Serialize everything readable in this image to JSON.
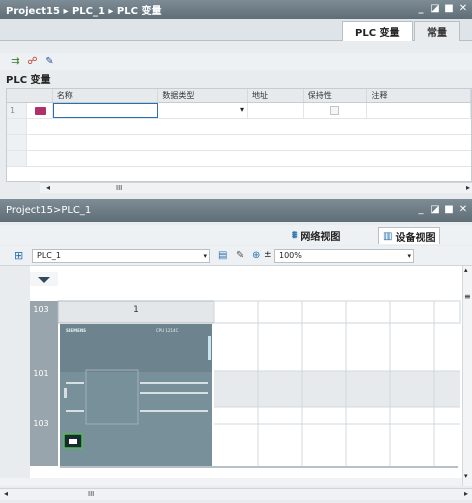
{
  "top_window": {
    "title": "Project15 ▸ PLC_1 ▸ PLC 变量",
    "controls": [
      "_",
      "◪",
      "■",
      "✕"
    ],
    "tabs": [
      {
        "label": "PLC 变量",
        "active": true
      },
      {
        "label": "常量",
        "active": false
      }
    ],
    "section": "PLC 变量",
    "columns": [
      "名称",
      "数据类型",
      "地址",
      "保持性",
      "注释"
    ],
    "rows": [
      {
        "num": "1"
      }
    ],
    "scroll_thumb": "III"
  },
  "bottom_window": {
    "title": "Project15>PLC_1",
    "controls": [
      "_",
      "◪",
      "■",
      "✕"
    ],
    "view_tabs": [
      {
        "label": "网络视图",
        "active": false
      },
      {
        "label": "设备视图",
        "active": true
      }
    ],
    "device_select": "PLC_1",
    "zoom": "100%",
    "rack": {
      "slot_numbers": [
        "103",
        "1"
      ],
      "row_labels": [
        "101",
        "103"
      ],
      "device_brand": "SIEMENS",
      "device_model": "CPU 1214C"
    },
    "scroll_thumb": "III"
  },
  "colors": {
    "accent": "#2a6fb0",
    "titlebar": "#6b7a83",
    "plc_body": "#78909a"
  }
}
